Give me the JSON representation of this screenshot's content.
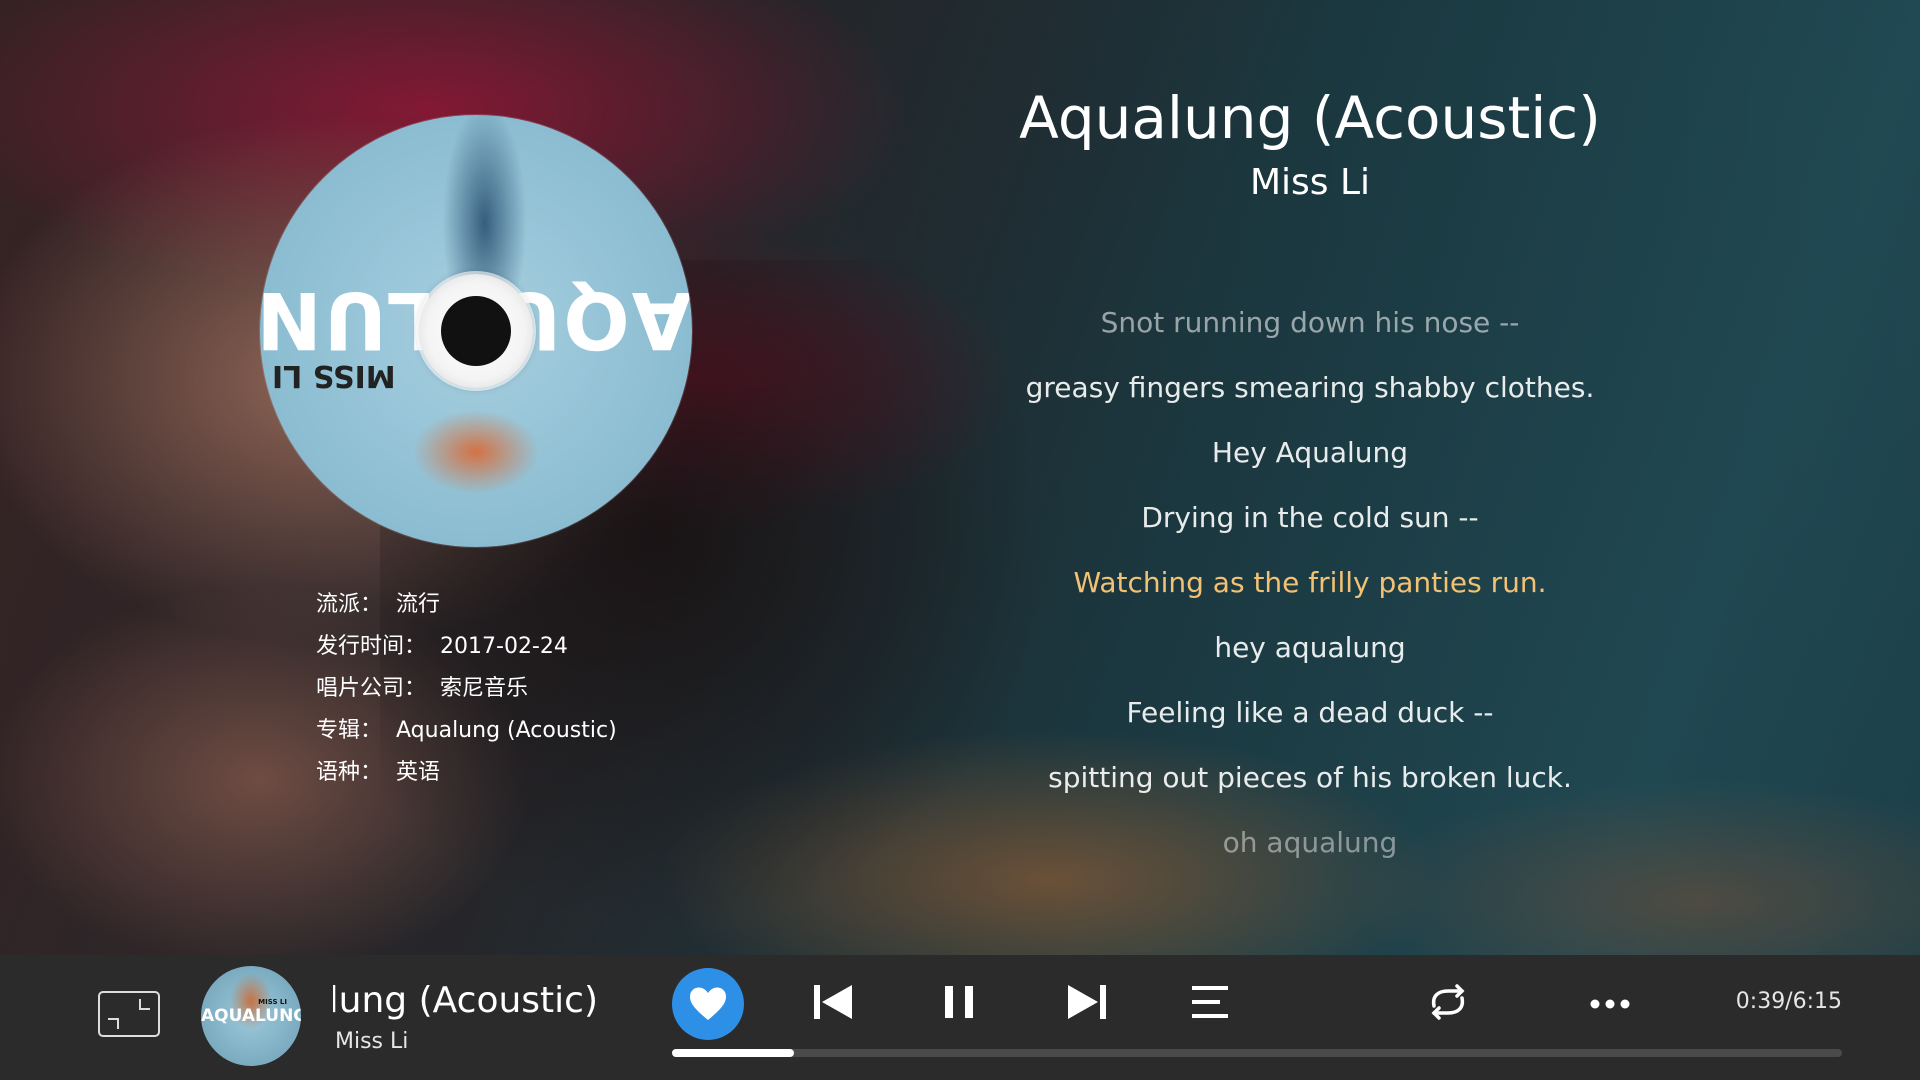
{
  "song": {
    "title": "Aqualung (Acoustic)",
    "artist": "Miss Li"
  },
  "disc": {
    "cover_title": "AQUALUNG",
    "cover_artist": "MISS LI"
  },
  "info": [
    {
      "label": "流派：",
      "value": "流行"
    },
    {
      "label": "发行时间：",
      "value": "2017-02-24"
    },
    {
      "label": "唱片公司：",
      "value": "索尼音乐"
    },
    {
      "label": "专辑：",
      "value": "Aqualung (Acoustic)"
    },
    {
      "label": "语种：",
      "value": "英语"
    }
  ],
  "lyrics": [
    "Snot running down his nose --",
    "greasy fingers smearing shabby clothes.",
    "Hey Aqualung",
    "Drying in the cold sun --",
    "Watching as the frilly panties run.",
    "hey aqualung",
    "Feeling like a dead duck --",
    "spitting out pieces of his broken luck.",
    "oh aqualung"
  ],
  "current_lyric_index": 4,
  "player": {
    "now_playing_title": "Aqualung (Acoustic)",
    "now_playing_artist": "Miss Li",
    "thumb_text": "AQUALUNG",
    "thumb_sub": "MISS LI",
    "time": "0:39/6:15",
    "progress_fraction": 0.104,
    "liked": true,
    "icons": {
      "fullscreen": "fullscreen-icon",
      "like": "heart-icon",
      "previous": "skip-previous-icon",
      "pause": "pause-icon",
      "next": "skip-next-icon",
      "playlist": "playlist-icon",
      "repeat": "repeat-icon",
      "more": "more-icon"
    }
  },
  "colors": {
    "current_lyric": "#f2c173",
    "like_button": "#2d8fe6",
    "bar_background": "#2b2b2b"
  }
}
